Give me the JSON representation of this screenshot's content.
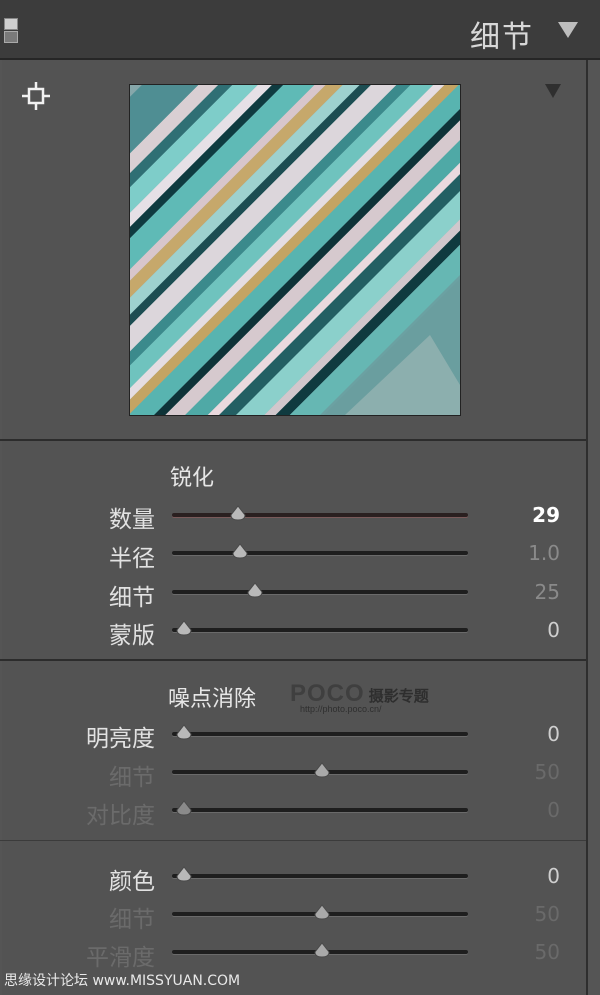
{
  "header": {
    "title": "细节"
  },
  "sharpening": {
    "title": "锐化",
    "rows": [
      {
        "label": "数量",
        "value": "29",
        "fraction": 0.22
      },
      {
        "label": "半径",
        "value": "1.0",
        "fraction": 0.23
      },
      {
        "label": "细节",
        "value": "25",
        "fraction": 0.28
      },
      {
        "label": "蒙版",
        "value": "0",
        "fraction": 0.0
      }
    ]
  },
  "noise": {
    "title": "噪点消除",
    "luminance_rows": [
      {
        "label": "明亮度",
        "value": "0",
        "fraction": 0.0
      },
      {
        "label": "细节",
        "value": "50",
        "fraction": 0.5
      },
      {
        "label": "对比度",
        "value": "0",
        "fraction": 0.0
      }
    ],
    "color_rows": [
      {
        "label": "颜色",
        "value": "0",
        "fraction": 0.0
      },
      {
        "label": "细节",
        "value": "50",
        "fraction": 0.5
      },
      {
        "label": "平滑度",
        "value": "50",
        "fraction": 0.5
      }
    ]
  },
  "watermark": {
    "brand": "POCO",
    "brand_cn": "摄影专题",
    "url": "http://photo.poco.cn/"
  },
  "footer": {
    "credit": "思缘设计论坛 www.MISSYUAN.COM"
  },
  "icons": [
    "panel-toggle-icon",
    "collapse-triangle-icon",
    "crosshair-icon",
    "preview-menu-icon",
    "slider-thumb-icon"
  ],
  "colors": {
    "panel_bg": "#535353",
    "header_bg": "#3c3c3c",
    "label": "#e2e2e2",
    "value_active": "#ffffff"
  }
}
